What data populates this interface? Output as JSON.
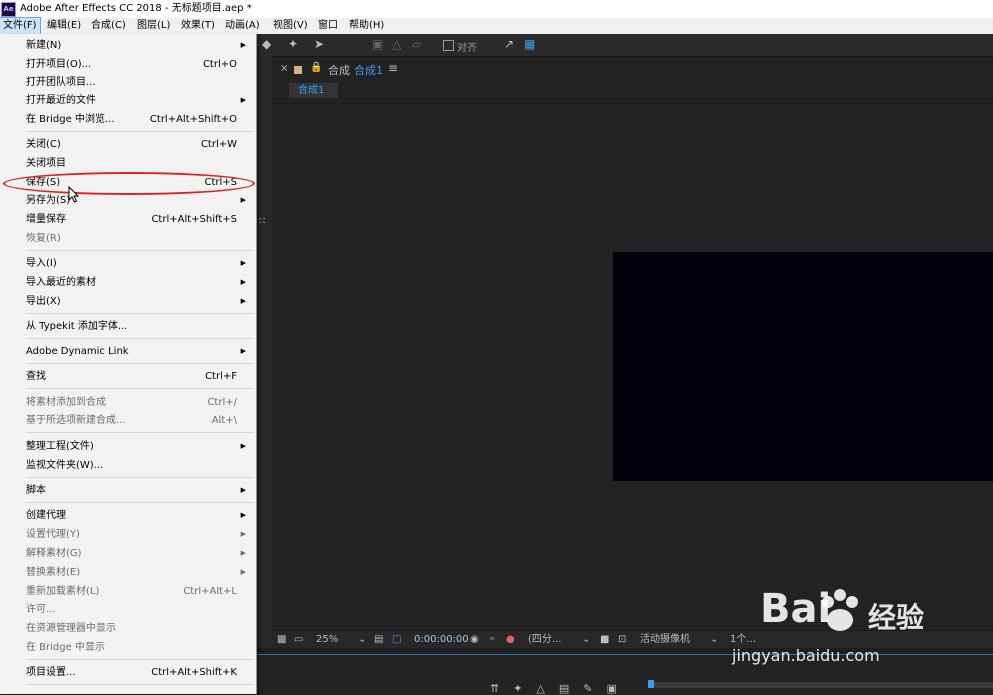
{
  "window": {
    "title": "Adobe After Effects CC 2018 - 无标题项目.aep *",
    "logo_text": "Ae"
  },
  "menubar": [
    {
      "label": "文件(F)"
    },
    {
      "label": "编辑(E)"
    },
    {
      "label": "合成(C)"
    },
    {
      "label": "图层(L)"
    },
    {
      "label": "效果(T)"
    },
    {
      "label": "动画(A)"
    },
    {
      "label": "视图(V)"
    },
    {
      "label": "窗口"
    },
    {
      "label": "帮助(H)"
    }
  ],
  "file_menu": {
    "items": [
      {
        "label": "新建(N)",
        "shortcut": "",
        "submenu": true,
        "enabled": true
      },
      {
        "label": "打开项目(O)...",
        "shortcut": "Ctrl+O",
        "submenu": false,
        "enabled": true
      },
      {
        "label": "打开团队项目...",
        "shortcut": "",
        "submenu": false,
        "enabled": true
      },
      {
        "label": "打开最近的文件",
        "shortcut": "",
        "submenu": true,
        "enabled": true
      },
      {
        "label": "在 Bridge 中浏览...",
        "shortcut": "Ctrl+Alt+Shift+O",
        "submenu": false,
        "enabled": true
      },
      {
        "label": "关闭(C)",
        "shortcut": "Ctrl+W",
        "submenu": false,
        "enabled": true
      },
      {
        "label": "关闭项目",
        "shortcut": "",
        "submenu": false,
        "enabled": true
      },
      {
        "label": "保存(S)",
        "shortcut": "Ctrl+S",
        "submenu": false,
        "enabled": true
      },
      {
        "label": "另存为(S)",
        "shortcut": "",
        "submenu": true,
        "enabled": true
      },
      {
        "label": "增量保存",
        "shortcut": "Ctrl+Alt+Shift+S",
        "submenu": false,
        "enabled": true
      },
      {
        "label": "恢复(R)",
        "shortcut": "",
        "submenu": false,
        "enabled": false
      },
      {
        "label": "导入(I)",
        "shortcut": "",
        "submenu": true,
        "enabled": true
      },
      {
        "label": "导入最近的素材",
        "shortcut": "",
        "submenu": true,
        "enabled": true
      },
      {
        "label": "导出(X)",
        "shortcut": "",
        "submenu": true,
        "enabled": true
      },
      {
        "label": "从 Typekit 添加字体...",
        "shortcut": "",
        "submenu": false,
        "enabled": true
      },
      {
        "label": "Adobe Dynamic Link",
        "shortcut": "",
        "submenu": true,
        "enabled": true
      },
      {
        "label": "查找",
        "shortcut": "Ctrl+F",
        "submenu": false,
        "enabled": true
      },
      {
        "label": "将素材添加到合成",
        "shortcut": "Ctrl+/",
        "submenu": false,
        "enabled": false
      },
      {
        "label": "基于所选项新建合成...",
        "shortcut": "Alt+\\",
        "submenu": false,
        "enabled": false
      },
      {
        "label": "整理工程(文件)",
        "shortcut": "",
        "submenu": true,
        "enabled": true
      },
      {
        "label": "监视文件夹(W)...",
        "shortcut": "",
        "submenu": false,
        "enabled": true
      },
      {
        "label": "脚本",
        "shortcut": "",
        "submenu": true,
        "enabled": true
      },
      {
        "label": "创建代理",
        "shortcut": "",
        "submenu": true,
        "enabled": true
      },
      {
        "label": "设置代理(Y)",
        "shortcut": "",
        "submenu": true,
        "enabled": false
      },
      {
        "label": "解释素材(G)",
        "shortcut": "",
        "submenu": true,
        "enabled": false
      },
      {
        "label": "替换素材(E)",
        "shortcut": "",
        "submenu": true,
        "enabled": false
      },
      {
        "label": "重新加载素材(L)",
        "shortcut": "Ctrl+Alt+L",
        "submenu": false,
        "enabled": false
      },
      {
        "label": "许可...",
        "shortcut": "",
        "submenu": false,
        "enabled": false
      },
      {
        "label": "在资源管理器中显示",
        "shortcut": "",
        "submenu": false,
        "enabled": false
      },
      {
        "label": "在 Bridge 中显示",
        "shortcut": "",
        "submenu": false,
        "enabled": false
      },
      {
        "label": "项目设置...",
        "shortcut": "Ctrl+Alt+Shift+K",
        "submenu": false,
        "enabled": true
      }
    ]
  },
  "toolbar": {
    "snap_label": "对齐"
  },
  "comp_panel": {
    "prefix": "合成",
    "name": "合成1",
    "subtab": "合成1"
  },
  "viewer_footer": {
    "zoom": "25%",
    "timecode": "0:00:00:00",
    "resolution": "(四分...",
    "camera": "活动摄像机",
    "views": "1个..."
  },
  "watermark": {
    "brand": "Bai",
    "cn": "经验",
    "url": "jingyan.baidu.com"
  },
  "colors": {
    "accent": "#3d9bea",
    "highlight_ring": "#e0211d",
    "comp_bg": "#03030c"
  }
}
